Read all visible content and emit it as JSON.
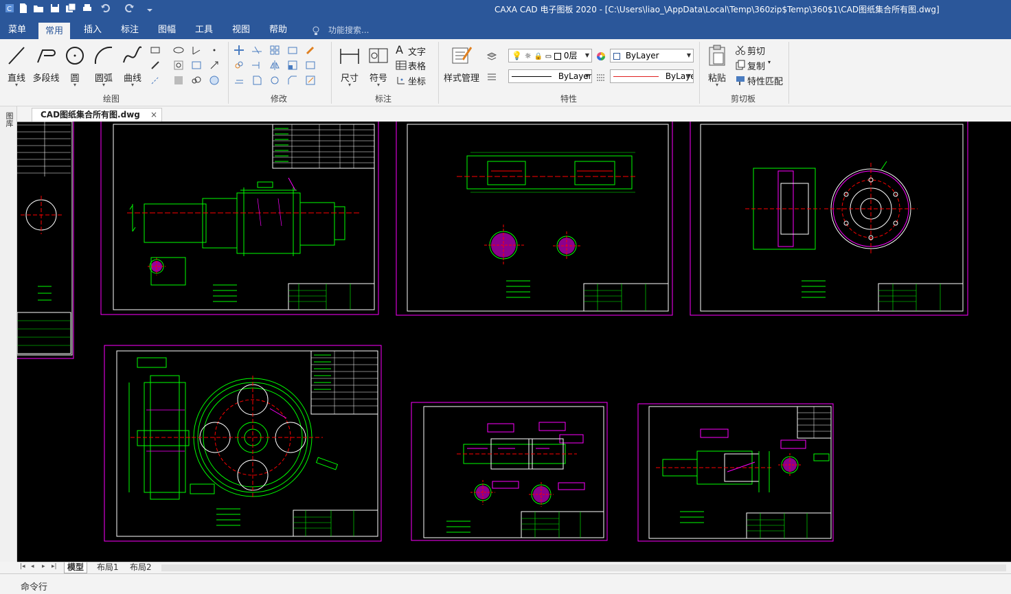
{
  "window": {
    "title": "CAXA CAD 电子图板 2020 - [C:\\Users\\liao_\\AppData\\Local\\Temp\\360zip$Temp\\360$1\\CAD图纸集合所有图.dwg]"
  },
  "quick_access": [
    "new-icon",
    "open-icon",
    "save-icon",
    "save-all-icon",
    "print-icon",
    "undo-icon",
    "redo-icon",
    "customize-icon"
  ],
  "tabs": [
    "菜单",
    "常用",
    "插入",
    "标注",
    "图幅",
    "工具",
    "视图",
    "帮助"
  ],
  "active_tab": "常用",
  "search": {
    "label": "功能搜索..."
  },
  "ribbon": {
    "draw": {
      "label": "绘图",
      "buttons": [
        "直线",
        "多段线",
        "圆",
        "圆弧",
        "曲线"
      ]
    },
    "modify": {
      "label": "修改"
    },
    "annotate": {
      "label": "标注",
      "buttons": [
        "尺寸",
        "符号"
      ],
      "small": [
        "文字",
        "表格",
        "坐标"
      ]
    },
    "properties": {
      "label": "特性",
      "style_button": "样式管理",
      "layer": "0层",
      "color": "ByLayer",
      "linetype": "ByLayer",
      "lineweight": "ByLaye"
    },
    "clipboard": {
      "label": "剪切板",
      "paste": "粘贴",
      "small": [
        "剪切",
        "复制",
        "特性匹配"
      ]
    }
  },
  "document_tab": {
    "label": "CAD图纸集合所有图.dwg",
    "close": "×"
  },
  "left_panel": {
    "label": "图库"
  },
  "layout_tabs": [
    "模型",
    "布局1",
    "布局2"
  ],
  "active_layout": "模型",
  "command_line": {
    "label": "命令行"
  },
  "colors": {
    "titlebar": "#2b579a",
    "canvas": "#000000",
    "frame": "#ff00ff",
    "drawing": "#00ff00",
    "centerline": "#ff0000",
    "border": "#ffffff"
  }
}
